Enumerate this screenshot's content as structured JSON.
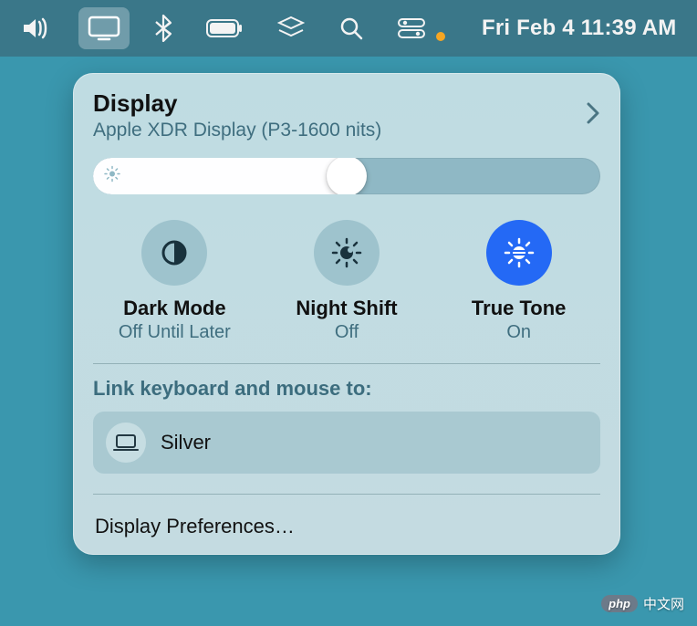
{
  "menubar": {
    "date_time": "Fri Feb 4  11:39 AM"
  },
  "panel": {
    "title": "Display",
    "subtitle": "Apple XDR Display (P3-1600 nits)",
    "brightness_percent": 50,
    "modes": {
      "dark_mode": {
        "title": "Dark Mode",
        "status": "Off Until Later"
      },
      "night_shift": {
        "title": "Night Shift",
        "status": "Off"
      },
      "true_tone": {
        "title": "True Tone",
        "status": "On"
      }
    },
    "link_label": "Link keyboard and mouse to:",
    "device": {
      "name": "Silver"
    },
    "prefs_label": "Display Preferences…"
  },
  "watermark": {
    "badge": "php",
    "text": "中文网"
  }
}
